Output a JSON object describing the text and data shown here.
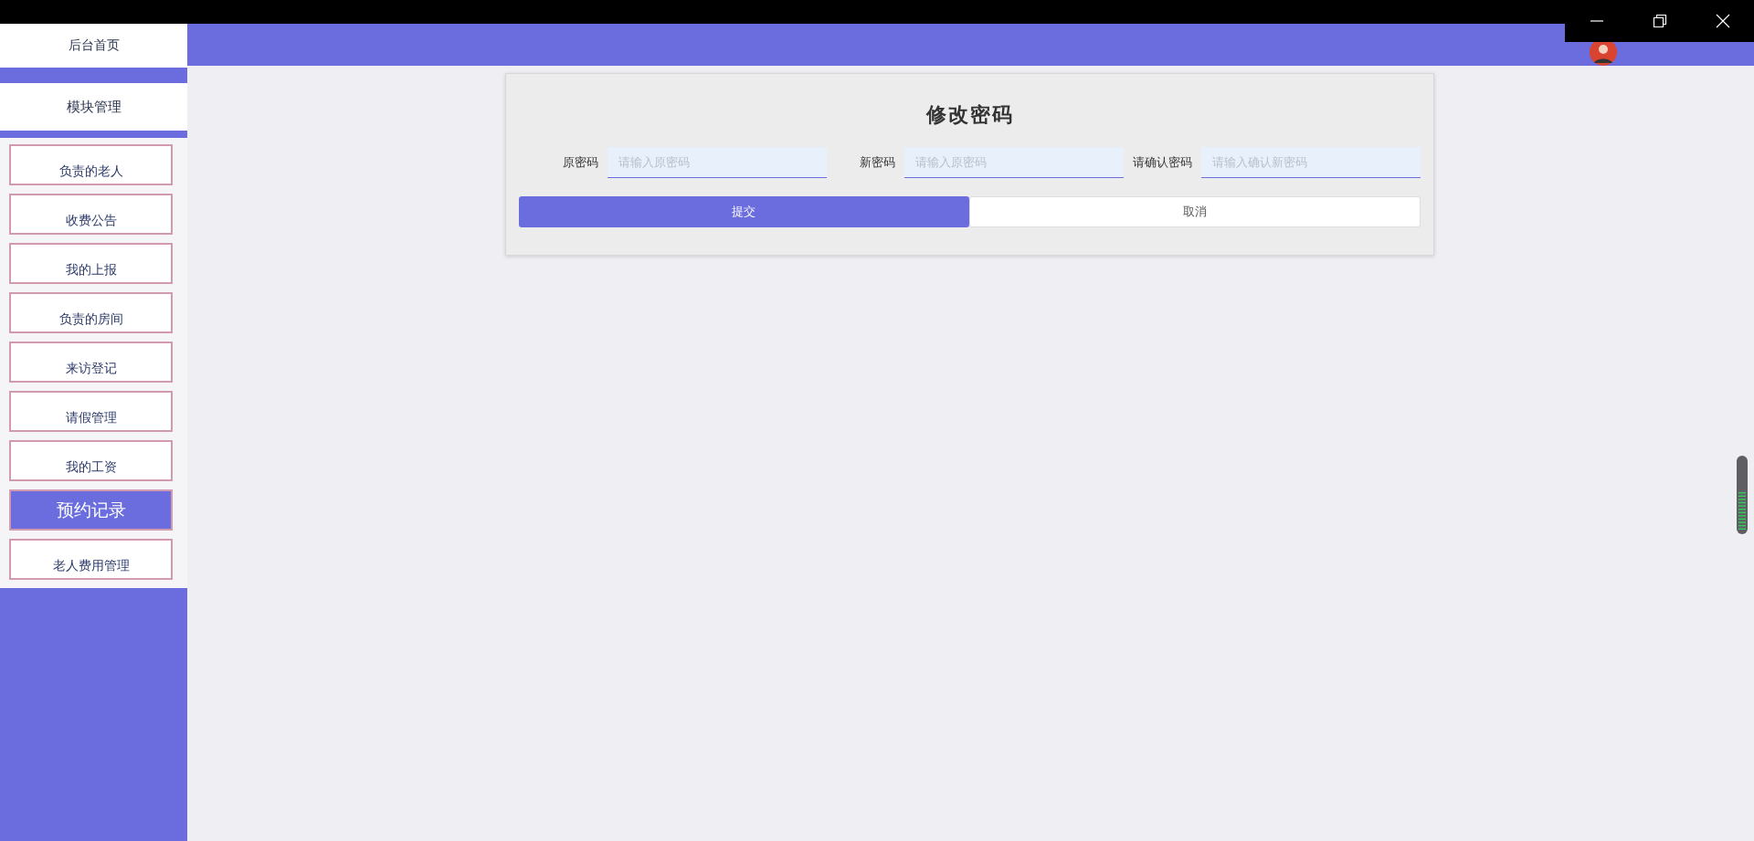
{
  "sidebar": {
    "home": "后台首页",
    "section": "模块管理",
    "items": [
      {
        "label": "负责的老人",
        "selected": false
      },
      {
        "label": "收费公告",
        "selected": false
      },
      {
        "label": "我的上报",
        "selected": false
      },
      {
        "label": "负责的房间",
        "selected": false
      },
      {
        "label": "来访登记",
        "selected": false
      },
      {
        "label": "请假管理",
        "selected": false
      },
      {
        "label": "我的工资",
        "selected": false
      },
      {
        "label": "预约记录",
        "selected": true
      },
      {
        "label": "老人费用管理",
        "selected": false
      }
    ]
  },
  "form": {
    "title": "修改密码",
    "fields": [
      {
        "label": "原密码",
        "placeholder": "请输入原密码"
      },
      {
        "label": "新密码",
        "placeholder": "请输入原密码"
      },
      {
        "label": "请确认密码",
        "placeholder": "请输入确认新密码"
      }
    ],
    "submit": "提交",
    "cancel": "取消"
  }
}
